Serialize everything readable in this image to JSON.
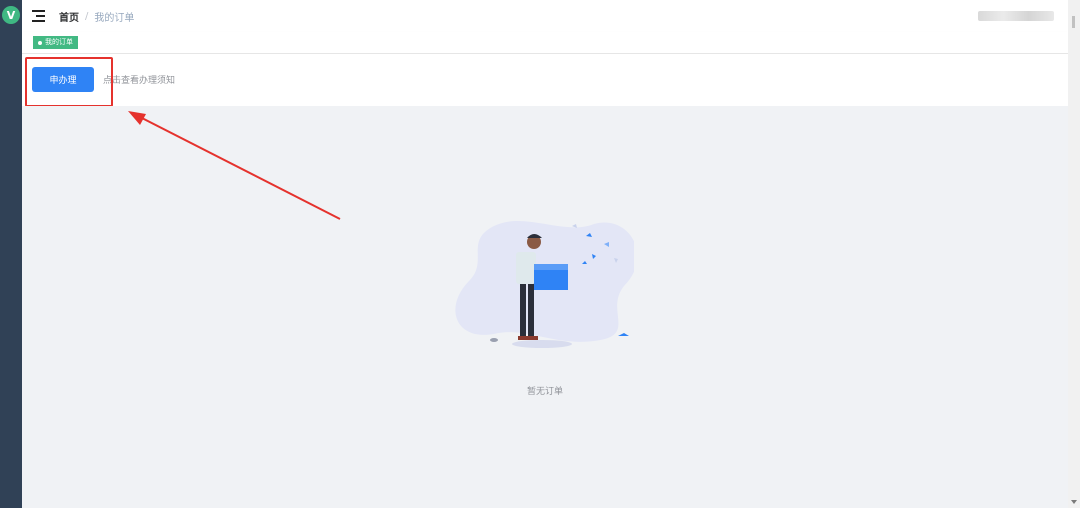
{
  "app": {
    "logo_letter": "V"
  },
  "navbar": {
    "breadcrumb": {
      "home": "首页",
      "separator": "/",
      "current": "我的订单"
    }
  },
  "tags": [
    {
      "label": "我的订单",
      "active": true
    }
  ],
  "action_bar": {
    "apply_button": "申办理",
    "notice_link": "点击查看办理须知"
  },
  "empty_state": {
    "text": "暂无订单"
  },
  "colors": {
    "sidebar": "#304156",
    "accent_green": "#42b983",
    "primary_blue": "#2f83f5",
    "annotation_red": "#e5322d",
    "content_bg": "#f0f2f5"
  }
}
